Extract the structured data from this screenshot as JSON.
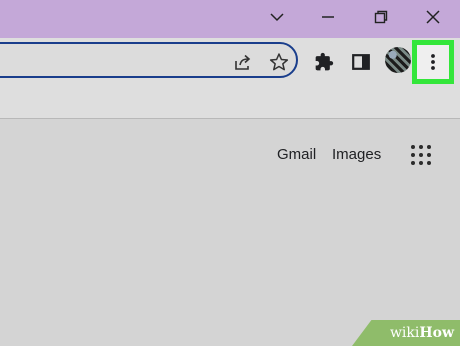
{
  "window_controls": {
    "tab_search": "chevron-down-icon",
    "minimize": "minimize-icon",
    "restore": "restore-icon",
    "close": "close-icon"
  },
  "toolbar": {
    "share_icon": "share-icon",
    "bookmark_icon": "star-icon",
    "extensions_icon": "puzzle-icon",
    "side_panel_icon": "side-panel-icon",
    "menu_icon": "vertical-dots-icon"
  },
  "content": {
    "gmail_link": "Gmail",
    "images_link": "Images",
    "apps_icon": "grid-icon"
  },
  "watermark": {
    "prefix": "wiki",
    "suffix": "How"
  },
  "colors": {
    "title_bar": "#c4a8d8",
    "omnibox_border": "#1a3e8c",
    "highlight": "#33e63a",
    "watermark": "#8fbc6a"
  }
}
